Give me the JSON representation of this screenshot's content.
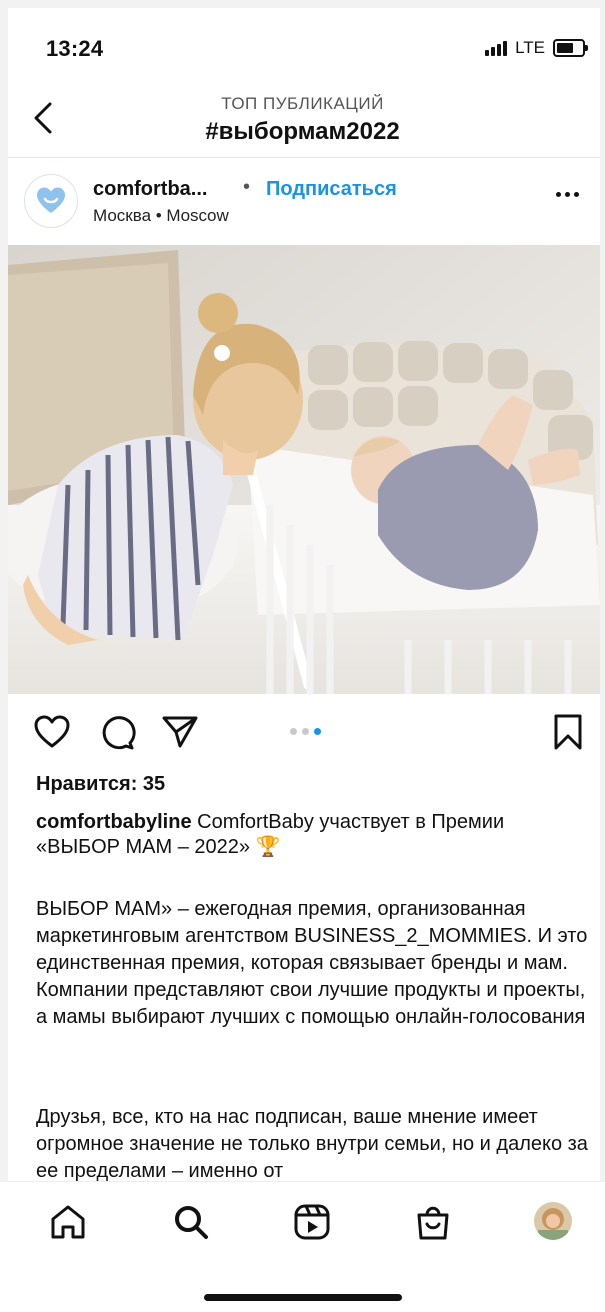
{
  "status_bar": {
    "time": "13:24",
    "network": "LTE"
  },
  "header": {
    "subtitle": "ТОП ПУБЛИКАЦИЙ",
    "title": "#выбормам2022"
  },
  "post": {
    "username": "comfortba...",
    "separator": "•",
    "follow_label": "Подписаться",
    "location": "Москва • Moscow",
    "carousel": {
      "count": 3,
      "active_index": 2
    },
    "likes": "Нравится: 35",
    "caption_user": "comfortbabyline",
    "caption_text": "ComfortBaby участвует в Премии «ВЫБОР МАМ – 2022» 🏆",
    "paragraph_1": "ВЫБОР МАМ» – ежегодная премия, организованная маркетинговым агентством BUSINESS_2_MOMMIES. И это единственная премия, которая связывает бренды и мам. Компании представляют свои лучшие продукты и проекты, а мамы выбирают лучших с помощью онлайн-голосования",
    "paragraph_2": "Друзья, все, кто на нас подписан, ваше мнение имеет огромное значение не только внутри семьи, но и далеко за ее пределами – именно от"
  },
  "icons": {
    "back": "chevron-left-icon",
    "like": "heart-icon",
    "comment": "comment-icon",
    "share": "paper-plane-icon",
    "save": "bookmark-icon",
    "nav": [
      "home-icon",
      "search-icon",
      "reels-icon",
      "shop-icon",
      "profile-avatar"
    ]
  },
  "colors": {
    "accent": "#1a93e6",
    "text": "#111111",
    "muted": "#555555"
  }
}
